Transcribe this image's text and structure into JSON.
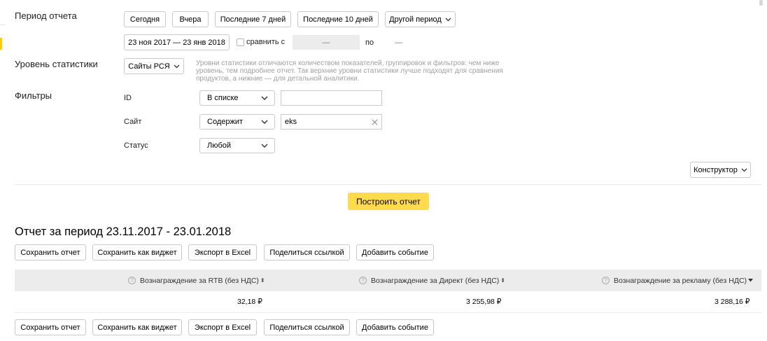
{
  "period": {
    "label": "Период отчета",
    "quick": [
      "Сегодня",
      "Вчера",
      "Последние 7 дней",
      "Последние 10 дней"
    ],
    "other": "Другой период",
    "range": "23 ноя 2017 — 23 янв 2018",
    "compare_label": "сравнить с",
    "compare_placeholder": "—",
    "to_label": "по",
    "to_value": "—"
  },
  "level": {
    "label": "Уровень статистики",
    "value": "Сайты РСЯ",
    "hint": "Уровни статистики отличаются количеством показателей, группировок и фильтров: чем ниже уровень, тем подробнее отчет. Так верхние уровни статистики лучше подходят для сравнения продуктов, а нижние — для детальной аналитики."
  },
  "filters": {
    "label": "Фильтры",
    "rows": [
      {
        "name": "ID",
        "op": "В списке",
        "value": ""
      },
      {
        "name": "Сайт",
        "op": "Содержит",
        "value": "eks"
      },
      {
        "name": "Статус",
        "op": "Любой"
      }
    ]
  },
  "constructor_label": "Конструктор",
  "build_label": "Построить отчет",
  "report": {
    "title": "Отчет за период 23.11.2017 - 23.01.2018",
    "actions": [
      "Сохранить отчет",
      "Сохранить как виджет",
      "Экспорт в Excel",
      "Поделиться ссылкой",
      "Добавить событие"
    ],
    "columns": [
      "Вознаграждение за RTB (без НДС)",
      "Вознаграждение за Директ (без НДС)",
      "Вознаграждение за рекламу (без НДС)"
    ],
    "values": [
      "32,18 ₽",
      "3 255,98 ₽",
      "3 288,16 ₽"
    ]
  },
  "colors": {
    "accent": "#ffdb4d",
    "table_header_bg": "#ececec",
    "left_marker": "#ffcc00"
  }
}
